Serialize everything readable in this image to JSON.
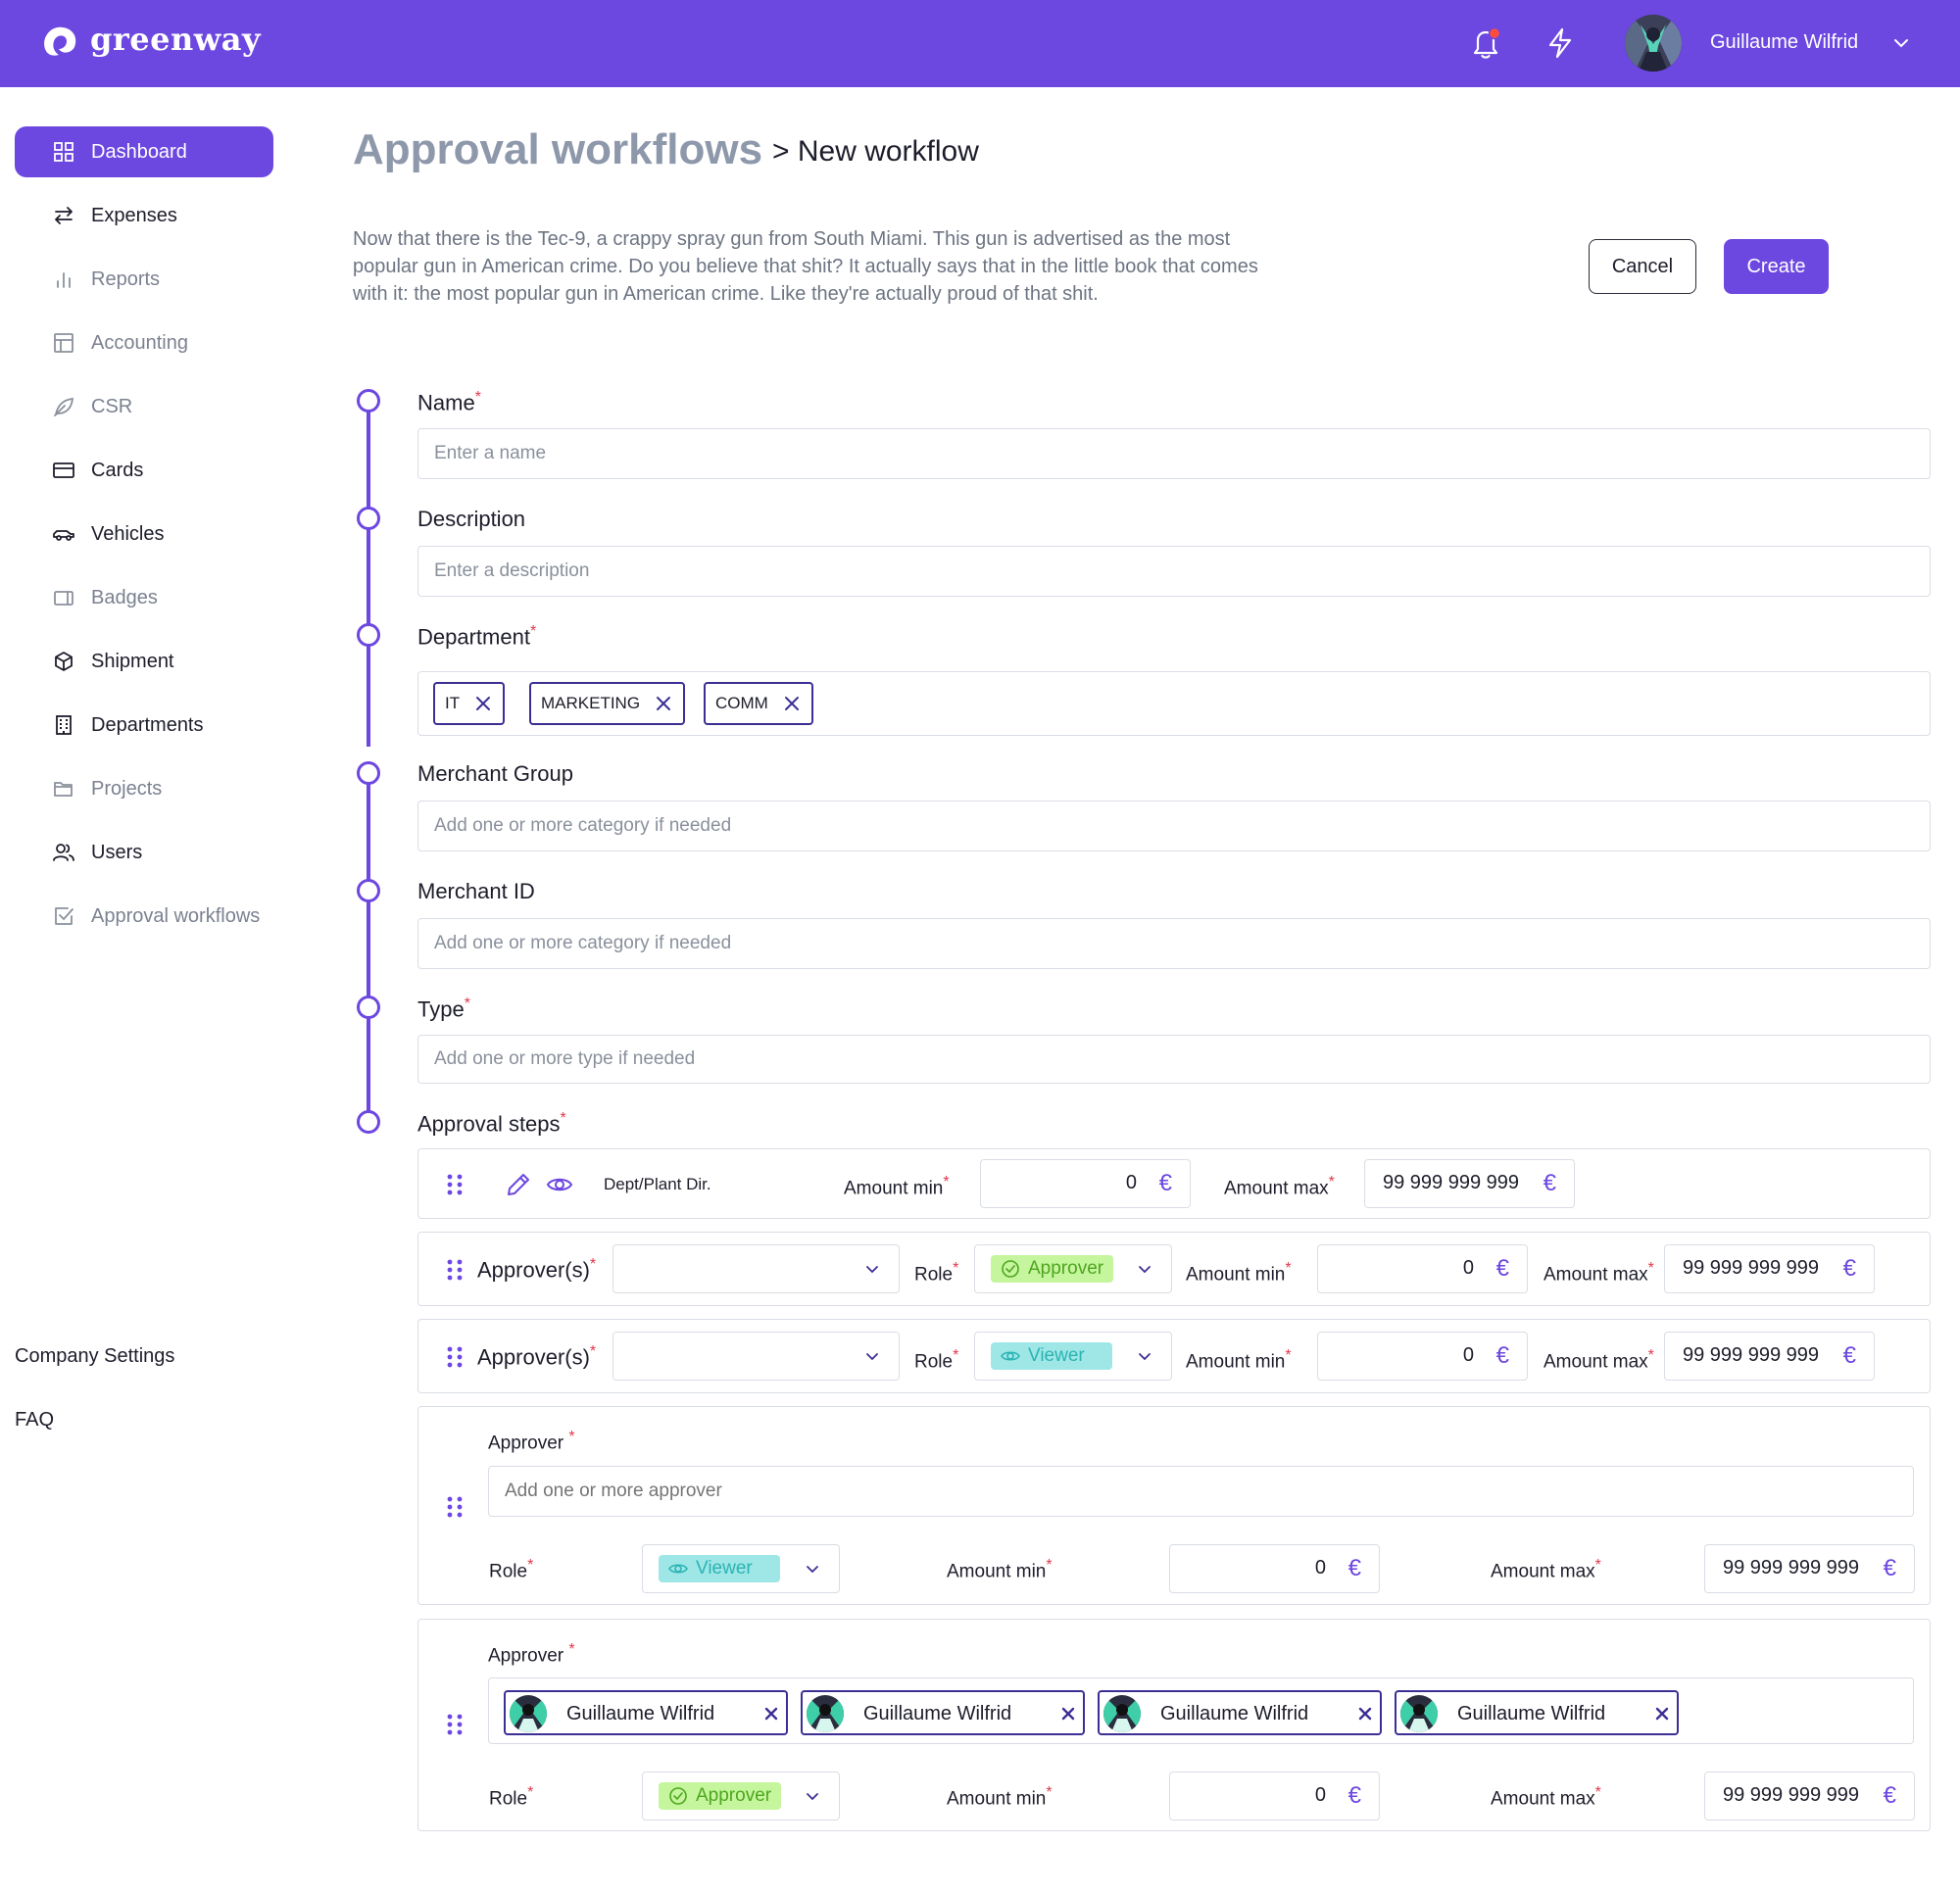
{
  "app": {
    "logo_text": "greenway"
  },
  "header": {
    "user_name": "Guillaume Wilfrid"
  },
  "sidebar": {
    "items": [
      {
        "label": "Dashboard",
        "icon": "grid-icon",
        "active": true
      },
      {
        "label": "Expenses",
        "icon": "arrows-exchange-icon"
      },
      {
        "label": "Reports",
        "icon": "bar-chart-icon",
        "muted": true
      },
      {
        "label": "Accounting",
        "icon": "table-icon",
        "muted": true
      },
      {
        "label": "CSR",
        "icon": "leaf-icon",
        "muted": true
      },
      {
        "label": "Cards",
        "icon": "credit-card-icon"
      },
      {
        "label": "Vehicles",
        "icon": "car-icon"
      },
      {
        "label": "Badges",
        "icon": "badge-icon",
        "muted": true
      },
      {
        "label": "Shipment",
        "icon": "box-icon"
      },
      {
        "label": "Departments",
        "icon": "building-icon"
      },
      {
        "label": "Projects",
        "icon": "folder-icon",
        "muted": true
      },
      {
        "label": "Users",
        "icon": "users-icon"
      },
      {
        "label": "Approval workflows",
        "icon": "checklist-icon",
        "muted": true
      }
    ],
    "footer": [
      "Company Settings",
      "FAQ"
    ]
  },
  "page": {
    "title": "Approval workflows",
    "breadcrumb": "> New workflow",
    "intro": "Now that there is the Tec-9, a crappy spray gun from South Miami. This gun is advertised as the most popular gun in American crime. Do you believe that shit? It actually says that in the little book that comes with it: the most popular gun in American crime. Like they're actually proud of that shit.",
    "cancel_label": "Cancel",
    "create_label": "Create"
  },
  "form": {
    "name": {
      "label": "Name",
      "required_mark": "*",
      "placeholder": "Enter a name"
    },
    "description": {
      "label": "Description",
      "placeholder": "Enter a description"
    },
    "department": {
      "label": "Department",
      "required_mark": "*",
      "tags": [
        "IT",
        "MARKETING",
        "COMM"
      ]
    },
    "merchant_group": {
      "label": "Merchant Group",
      "placeholder": "Add one or more category if needed"
    },
    "merchant_id": {
      "label": "Merchant ID",
      "placeholder": "Add one or more category if needed"
    },
    "type": {
      "label": "Type",
      "required_mark": "*",
      "placeholder": "Add one or more type if needed"
    },
    "approval_steps": {
      "label": "Approval steps",
      "required_mark": "*"
    }
  },
  "steps": {
    "labels": {
      "amount_min": "Amount min",
      "amount_max": "Amount max",
      "approvers": "Approver(s)",
      "approver": "Approver",
      "role": "Role",
      "currency": "€",
      "approver_placeholder": "Add one or more approver"
    },
    "step1": {
      "name": "Dept/Plant Dir.",
      "amount_min": "0",
      "amount_max": "99 999 999 999"
    },
    "step2": {
      "role": "Approver",
      "amount_min": "0",
      "amount_max": "99 999 999 999"
    },
    "step3": {
      "role": "Viewer",
      "amount_min": "0",
      "amount_max": "99 999 999 999"
    },
    "step4": {
      "role": "Viewer",
      "amount_min": "0",
      "amount_max": "99 999 999 999"
    },
    "step5": {
      "people": [
        "Guillaume Wilfrid",
        "Guillaume Wilfrid",
        "Guillaume Wilfrid",
        "Guillaume Wilfrid"
      ],
      "role": "Approver",
      "amount_min": "0",
      "amount_max": "99 999 999 999"
    }
  },
  "colors": {
    "brand": "#6c47e0",
    "approver_pill_bg": "#c5f59d",
    "approver_pill_text": "#4ea61f",
    "viewer_pill_bg": "#9fe7e7",
    "viewer_pill_text": "#2cb3b3",
    "required": "#e0384a"
  }
}
